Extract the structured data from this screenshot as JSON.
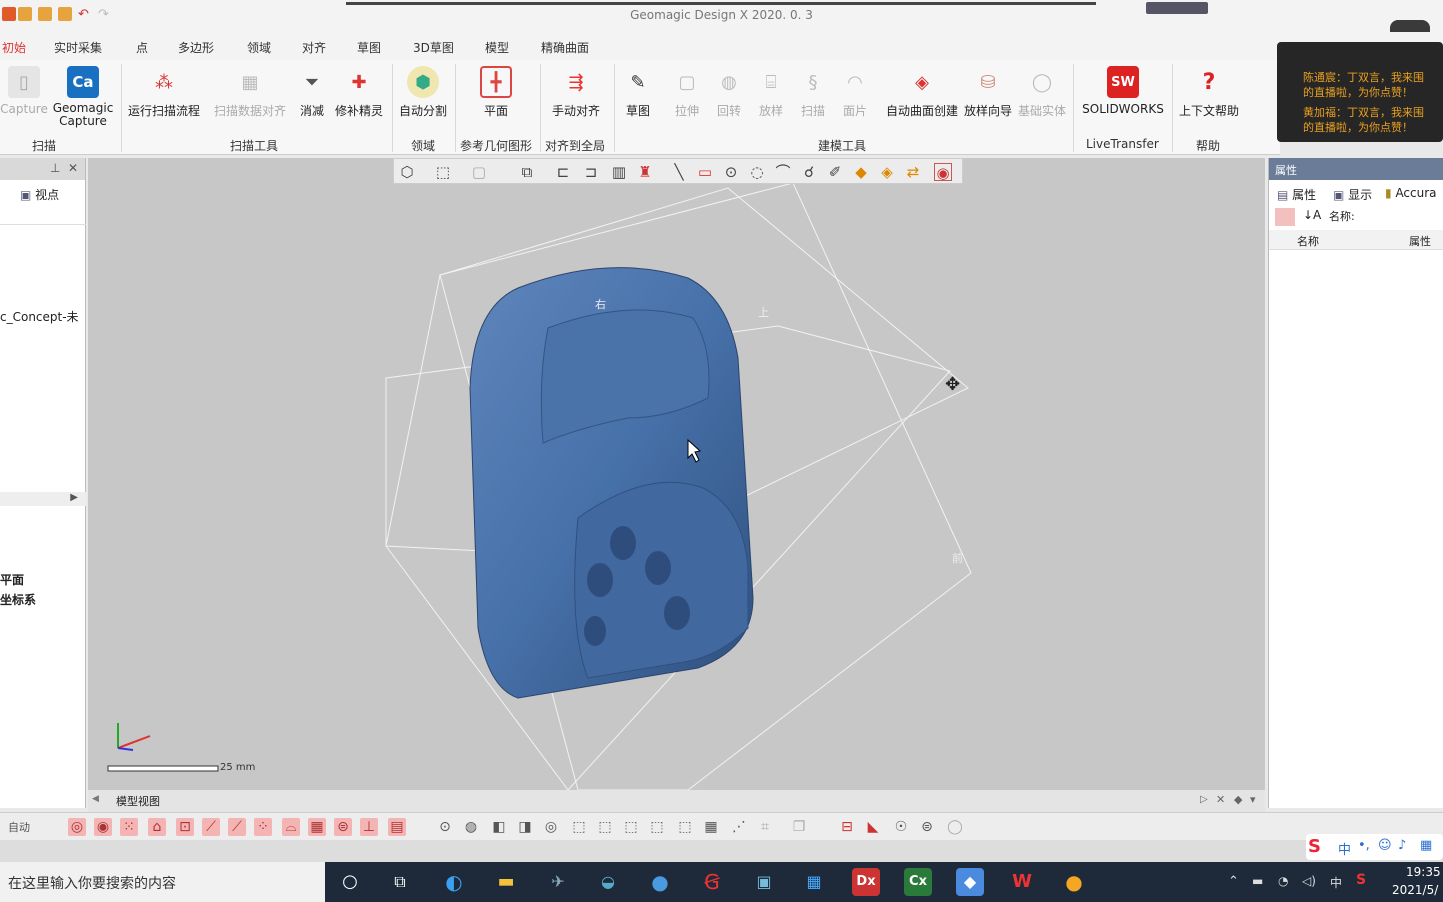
{
  "window": {
    "title": "Geomagic Design X 2020. 0. 3"
  },
  "menu": {
    "items": [
      "初始",
      "实时采集",
      "点",
      "多边形",
      "领域",
      "对齐",
      "草图",
      "3D草图",
      "模型",
      "精确曲面"
    ]
  },
  "ribbon": {
    "buttons": [
      {
        "label": "Capture",
        "disabled": true
      },
      {
        "label": "Geomagic Capture",
        "disabled": false
      },
      {
        "label": "运行扫描流程",
        "disabled": false
      },
      {
        "label": "扫描数据对齐",
        "disabled": true
      },
      {
        "label": "消减",
        "disabled": false
      },
      {
        "label": "修补精灵",
        "disabled": false
      },
      {
        "label": "自动分割",
        "disabled": false
      },
      {
        "label": "平面",
        "disabled": false
      },
      {
        "label": "手动对齐",
        "disabled": false
      },
      {
        "label": "草图",
        "disabled": false
      },
      {
        "label": "拉伸",
        "disabled": true
      },
      {
        "label": "回转",
        "disabled": true
      },
      {
        "label": "放样",
        "disabled": true
      },
      {
        "label": "扫描",
        "disabled": true
      },
      {
        "label": "面片",
        "disabled": true
      },
      {
        "label": "自动曲面创建",
        "disabled": false
      },
      {
        "label": "放样向导",
        "disabled": false
      },
      {
        "label": "基础实体",
        "disabled": true
      },
      {
        "label": "SOLIDWORKS",
        "disabled": false
      },
      {
        "label": "上下文帮助",
        "disabled": false
      }
    ],
    "groups": [
      "扫描",
      "扫描工具",
      "领域",
      "参考几何图形",
      "对齐到全局",
      "建模工具",
      "LiveTransfer",
      "帮助"
    ]
  },
  "chat": {
    "lines": [
      "陈通宸：丁双言，我来围",
      "的直播啦，为你点赞！",
      "黄加福：丁双言，我来围",
      "的直播啦，为你点赞！"
    ]
  },
  "left_panel": {
    "tab_view": "视点",
    "tree_item": "c_Concept-未",
    "items": [
      "平面",
      "坐标系"
    ]
  },
  "right_panel": {
    "header": "属性",
    "tabs": [
      "属性",
      "显示",
      "Accura"
    ],
    "name_label": "名称:",
    "col_name": "名称",
    "col_prop": "属性"
  },
  "viewport": {
    "label_right": "右",
    "label_top": "上",
    "label_front": "前",
    "scale_text": "25 mm"
  },
  "bottom": {
    "tab": "模型视图",
    "mode": "自动"
  },
  "taskbar": {
    "search_placeholder": "在这里输入你要搜索的内容",
    "time": "19:35",
    "date": "2021/5/",
    "ime": "中"
  }
}
